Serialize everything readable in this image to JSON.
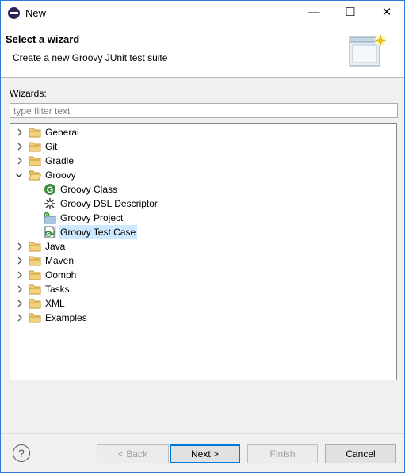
{
  "window": {
    "title": "New",
    "minimize_glyph": "—",
    "maximize_glyph": "☐",
    "close_glyph": "✕"
  },
  "header": {
    "title": "Select a wizard",
    "description": "Create a new Groovy JUnit test suite"
  },
  "filter": {
    "label": "Wizards:",
    "placeholder": "type filter text",
    "value": ""
  },
  "tree": {
    "items": [
      {
        "label": "General",
        "expanded": false
      },
      {
        "label": "Git",
        "expanded": false
      },
      {
        "label": "Gradle",
        "expanded": false
      },
      {
        "label": "Groovy",
        "expanded": true
      },
      {
        "label": "Groovy Class",
        "icon": "groovy-class-icon"
      },
      {
        "label": "Groovy DSL Descriptor",
        "icon": "dsl-descriptor-icon"
      },
      {
        "label": "Groovy Project",
        "icon": "groovy-project-icon"
      },
      {
        "label": "Groovy Test Case",
        "icon": "groovy-test-case-icon",
        "selected": true
      },
      {
        "label": "Java",
        "expanded": false
      },
      {
        "label": "Maven",
        "expanded": false
      },
      {
        "label": "Oomph",
        "expanded": false
      },
      {
        "label": "Tasks",
        "expanded": false
      },
      {
        "label": "XML",
        "expanded": false
      },
      {
        "label": "Examples",
        "expanded": false
      }
    ]
  },
  "buttons": {
    "help": "?",
    "back": "< Back",
    "next": "Next >",
    "finish": "Finish",
    "cancel": "Cancel"
  },
  "colors": {
    "selection": "#cde8ff",
    "folder": "#dcb35c",
    "default_border": "#0078d7"
  }
}
